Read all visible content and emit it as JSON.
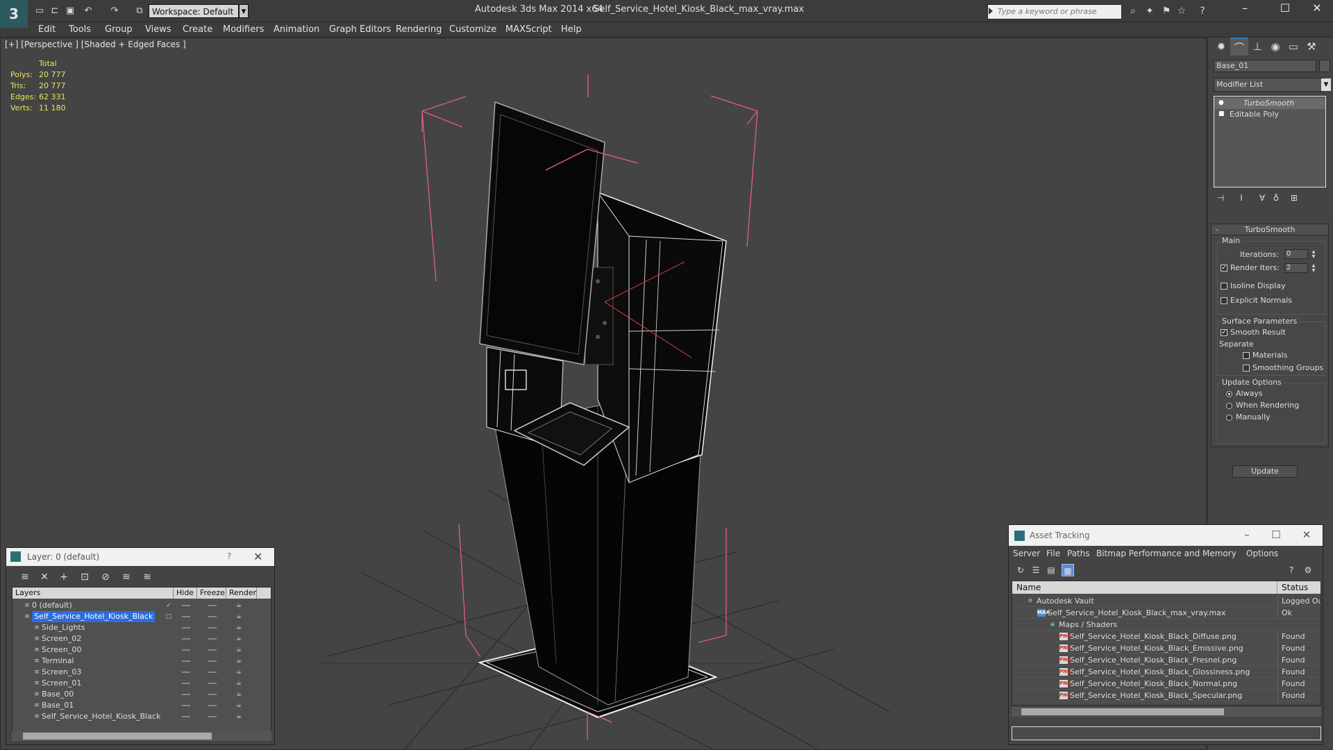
{
  "titlebar": {
    "logo": "3",
    "workspace": "Workspace: Default",
    "app": "Autodesk 3ds Max  2014 x64",
    "file": "Self_Service_Hotel_Kiosk_Black_max_vray.max",
    "search_placeholder": "Type a keyword or phrase"
  },
  "menu": [
    "Edit",
    "Tools",
    "Group",
    "Views",
    "Create",
    "Modifiers",
    "Animation",
    "Graph Editors",
    "Rendering",
    "Customize",
    "MAXScript",
    "Help"
  ],
  "viewport": {
    "label": "[+] [Perspective ] [Shaded + Edged Faces ]",
    "stats": {
      "header": "Total",
      "rows": [
        {
          "label": "Polys:",
          "value": "20 777"
        },
        {
          "label": "Tris:",
          "value": "20 777"
        },
        {
          "label": "Edges:",
          "value": "62 331"
        },
        {
          "label": "Verts:",
          "value": "11 180"
        }
      ]
    }
  },
  "command_panel": {
    "object_name": "Base_01",
    "modifier_list": "Modifier List",
    "stack": [
      "TurboSmooth",
      "Editable Poly"
    ],
    "rollout": {
      "title": "TurboSmooth",
      "main_group": "Main",
      "iterations_label": "Iterations:",
      "iterations_value": "0",
      "render_iters_label": "Render Iters:",
      "render_iters_value": "2",
      "isoline": "Isoline Display",
      "explicit_normals": "Explicit Normals",
      "surface_group": "Surface Parameters",
      "smooth_result": "Smooth Result",
      "separate": "Separate",
      "materials": "Materials",
      "smoothing_groups": "Smoothing Groups",
      "update_group": "Update Options",
      "always": "Always",
      "when_rendering": "When Rendering",
      "manually": "Manually",
      "update_button": "Update"
    }
  },
  "layer_dialog": {
    "title": "Layer: 0 (default)",
    "help": "?",
    "columns": [
      "Layers",
      "Hide",
      "Freeze",
      "Render"
    ],
    "rows": [
      {
        "name": "0 (default)",
        "level": 0
      },
      {
        "name": "Self_Service_Hotel_Kiosk_Black",
        "level": 0
      },
      {
        "name": "Side_Lights",
        "level": 1
      },
      {
        "name": "Screen_02",
        "level": 1
      },
      {
        "name": "Screen_00",
        "level": 1
      },
      {
        "name": "Terminal",
        "level": 1
      },
      {
        "name": "Screen_03",
        "level": 1
      },
      {
        "name": "Screen_01",
        "level": 1
      },
      {
        "name": "Base_00",
        "level": 1
      },
      {
        "name": "Base_01",
        "level": 1
      },
      {
        "name": "Self_Service_Hotel_Kiosk_Black",
        "level": 1
      }
    ]
  },
  "asset_dialog": {
    "title": "Asset Tracking",
    "menu": [
      "Server",
      "File",
      "Paths",
      "Bitmap Performance and Memory",
      "Options"
    ],
    "columns": [
      "Name",
      "Status"
    ],
    "rows": [
      {
        "name": "Autodesk Vault",
        "status": "Logged Ou",
        "level": 0,
        "icon": "vault"
      },
      {
        "name": "Self_Service_Hotel_Kiosk_Black_max_vray.max",
        "status": "Ok",
        "level": 1,
        "icon": "max"
      },
      {
        "name": "Maps / Shaders",
        "status": "",
        "level": 2,
        "icon": "maps"
      },
      {
        "name": "Self_Service_Hotel_Kiosk_Black_Diffuse.png",
        "status": "Found",
        "level": 3,
        "icon": "png"
      },
      {
        "name": "Self_Service_Hotel_Kiosk_Black_Emissive.png",
        "status": "Found",
        "level": 3,
        "icon": "png"
      },
      {
        "name": "Self_Service_Hotel_Kiosk_Black_Fresnel.png",
        "status": "Found",
        "level": 3,
        "icon": "png"
      },
      {
        "name": "Self_Service_Hotel_Kiosk_Black_Glossiness.png",
        "status": "Found",
        "level": 3,
        "icon": "png"
      },
      {
        "name": "Self_Service_Hotel_Kiosk_Black_Normal.png",
        "status": "Found",
        "level": 3,
        "icon": "png"
      },
      {
        "name": "Self_Service_Hotel_Kiosk_Black_Specular.png",
        "status": "Found",
        "level": 3,
        "icon": "png"
      }
    ]
  },
  "colors": {
    "selection": "#2d6ddd",
    "stats_text": "#e8e560",
    "bounding_box": "#e0607a"
  }
}
